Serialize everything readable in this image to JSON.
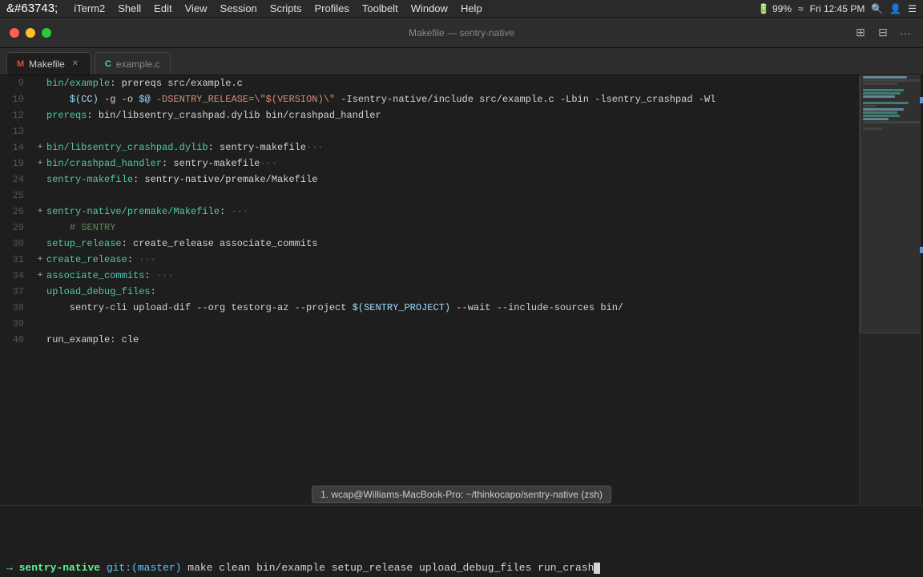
{
  "menubar": {
    "apple": "&#63743;",
    "items": [
      "iTerm2",
      "Shell",
      "Edit",
      "View",
      "Session",
      "Scripts",
      "Profiles",
      "Toolbelt",
      "Window",
      "Help"
    ],
    "right": {
      "battery": "99%",
      "time": "Fri 12:45 PM"
    }
  },
  "titlebar": {
    "title": "Makefile — sentry-native"
  },
  "tabs": [
    {
      "id": "makefile",
      "icon": "M",
      "label": "Makefile",
      "active": true
    },
    {
      "id": "example-c",
      "icon": "C",
      "label": "example.c",
      "active": false
    }
  ],
  "toolbar": {
    "icon1": "⊞",
    "icon2": "⊟",
    "icon3": "···"
  },
  "code": {
    "lines": [
      {
        "num": "9",
        "expand": "",
        "content": "bin/example: prereqs src/example.c"
      },
      {
        "num": "10",
        "expand": "",
        "content": "    $(CC) -g -o $@ -DSENTRY_RELEASE=\\\"$(VERSION)\\\" -Isentry-native/include src/example.c -Lbin -lsentry_crashpad -Wl"
      },
      {
        "num": "12",
        "expand": "",
        "content": "prereqs: bin/libsentry_crashpad.dylib bin/crashpad_handler"
      },
      {
        "num": "13",
        "expand": "",
        "content": ""
      },
      {
        "num": "14",
        "expand": "+",
        "content": "bin/libsentry_crashpad.dylib: sentry-makefile···"
      },
      {
        "num": "19",
        "expand": "+",
        "content": "bin/crashpad_handler: sentry-makefile···"
      },
      {
        "num": "24",
        "expand": "",
        "content": "sentry-makefile: sentry-native/premake/Makefile"
      },
      {
        "num": "25",
        "expand": "",
        "content": ""
      },
      {
        "num": "26",
        "expand": "+",
        "content": "sentry-native/premake/Makefile: ···"
      },
      {
        "num": "29",
        "expand": "",
        "content": "    # SENTRY"
      },
      {
        "num": "30",
        "expand": "",
        "content": "setup_release: create_release associate_commits"
      },
      {
        "num": "31",
        "expand": "+",
        "content": "create_release: ···"
      },
      {
        "num": "34",
        "expand": "+",
        "content": "associate_commits: ···"
      },
      {
        "num": "37",
        "expand": "",
        "content": "upload_debug_files:"
      },
      {
        "num": "38",
        "expand": "",
        "content": "    sentry-cli upload-dif --org testorg-az --project $(SENTRY_PROJECT) --wait --include-sources bin/"
      },
      {
        "num": "39",
        "expand": "",
        "content": ""
      },
      {
        "num": "40",
        "expand": "",
        "content": "run_example: cle"
      }
    ]
  },
  "terminal": {
    "tooltip": "1. wcap@Williams-MacBook-Pro: ~/thinkocapo/sentry-native (zsh)",
    "prompt_arrow": "→",
    "path": "sentry-native",
    "git_branch": "git:(master)",
    "command": "make clean bin/example setup_release upload_debug_files run_crash"
  }
}
